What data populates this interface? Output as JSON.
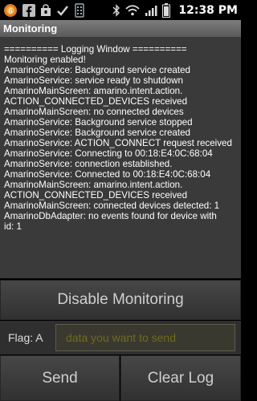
{
  "status_bar": {
    "notification_count": "6",
    "time": "12:38 PM",
    "icons": [
      "firefox-notification-icon",
      "facebook-icon",
      "shopping-bag-icon",
      "check-icon",
      "usb-icon",
      "bluetooth-icon",
      "wifi-icon",
      "signal-icon",
      "battery-icon"
    ]
  },
  "title_bar": {
    "title": "Monitoring"
  },
  "log": {
    "lines": [
      "========== Logging Window ==========",
      "Monitoring enabled!",
      "AmarinoService: Background service created",
      "AmarinoService: service ready to shutdown",
      "AmarinoMainScreen: amarino.intent.action.",
      "ACTION_CONNECTED_DEVICES received",
      "AmarinoMainScreen: no connected devices",
      "AmarinoService: Background service stopped",
      "AmarinoService: Background service created",
      "AmarinoService: ACTION_CONNECT request received",
      "AmarinoService: Connecting to 00:18:E4:0C:68:04",
      "AmarinoService: connection established.",
      "AmarinoService: Connected to 00:18:E4:0C:68:04",
      "AmarinoMainScreen: amarino.intent.action.",
      "ACTION_CONNECTED_DEVICES received",
      "AmarinoMainScreen: connected devices detected: 1",
      "AmarinoDbAdapter: no events found for device with",
      "id: 1"
    ]
  },
  "buttons": {
    "disable_monitoring": "Disable Monitoring",
    "send": "Send",
    "clear_log": "Clear Log"
  },
  "flag": {
    "label": "Flag: A",
    "input_value": "",
    "input_placeholder": "data you want to send"
  },
  "colors": {
    "log_background": "#3a3a3a",
    "title_bar": "#6b6b6b",
    "placeholder": "#6f6b1f"
  }
}
